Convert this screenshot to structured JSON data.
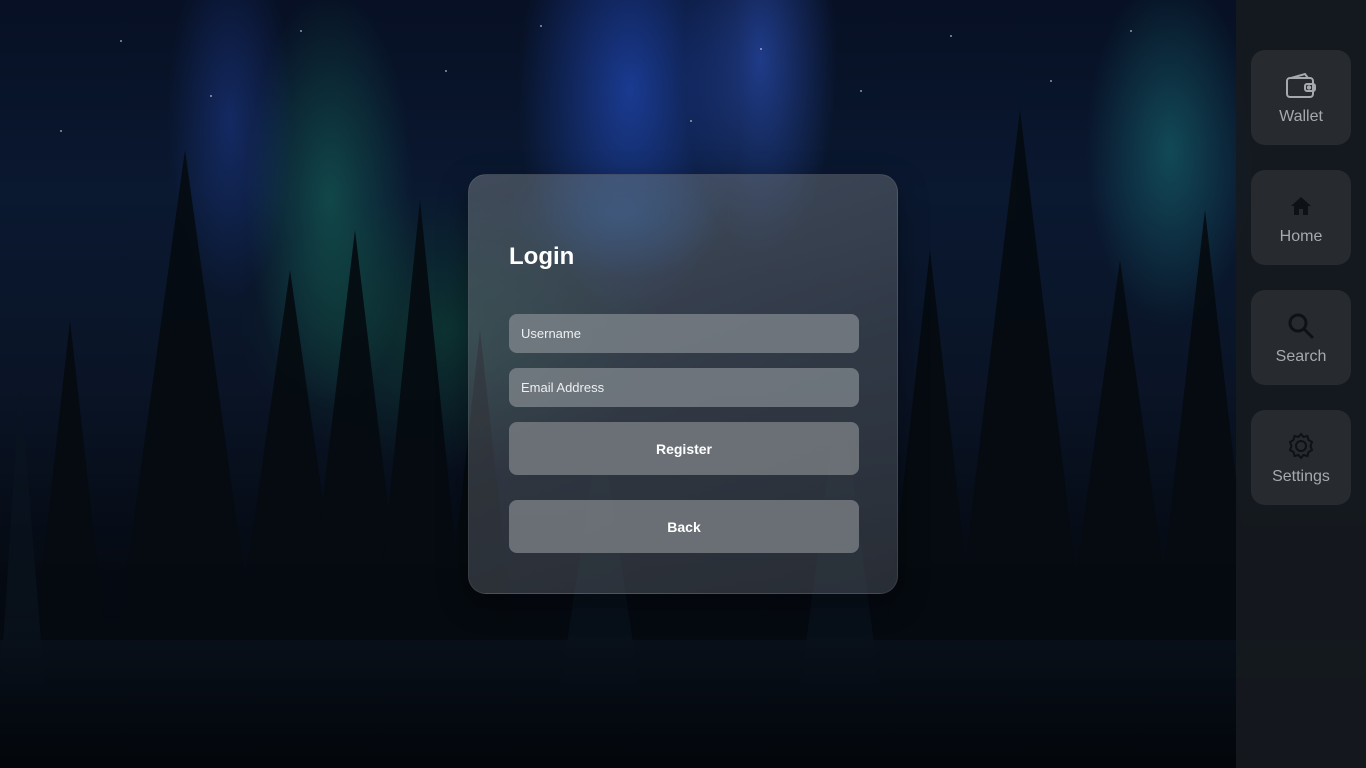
{
  "login": {
    "title": "Login",
    "username_placeholder": "Username",
    "email_placeholder": "Email Address",
    "register_label": "Register",
    "back_label": "Back"
  },
  "sidebar": {
    "items": [
      {
        "label": "Wallet",
        "icon": "wallet-icon"
      },
      {
        "label": "Home",
        "icon": "home-icon"
      },
      {
        "label": "Search",
        "icon": "search-icon"
      },
      {
        "label": "Settings",
        "icon": "gear-icon"
      }
    ]
  },
  "colors": {
    "card_bg": "#5a6068",
    "input_bg": "#82888e",
    "button_bg": "#767a80",
    "sidebar_bg": "#161a20",
    "sidebar_item_bg": "#282c32",
    "sidebar_text": "#a6a9ae"
  }
}
